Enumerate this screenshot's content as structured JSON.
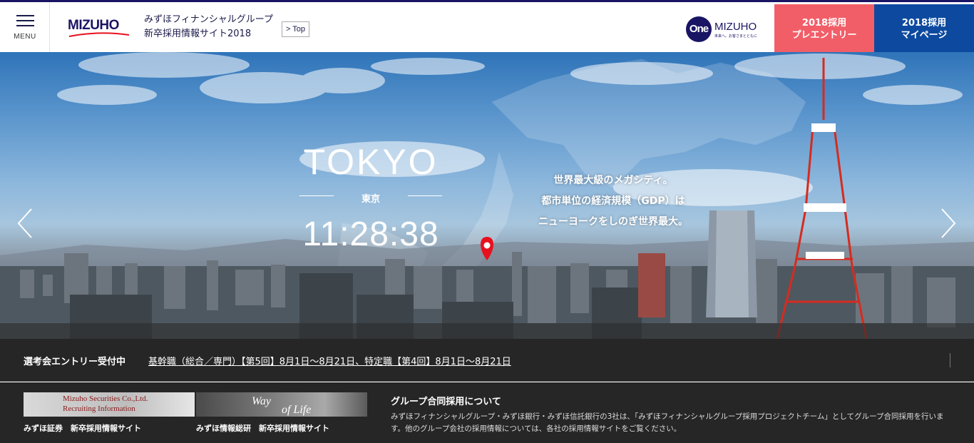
{
  "header": {
    "menu_label": "MENU",
    "logo_text": "MIZUHO",
    "site_title_line1": "みずほフィナンシャルグループ",
    "site_title_line2": "新卒採用情報サイト2018",
    "top_link": "> Top",
    "one_logo_circle": "One",
    "one_logo_text": "MIZUHO",
    "one_logo_tagline": "未来へ。お客さまとともに",
    "entry_button_line1": "2018採用",
    "entry_button_line2": "プレエントリー",
    "mypage_button_line1": "2018採用",
    "mypage_button_line2": "マイページ"
  },
  "hero": {
    "city_name": "TOKYO",
    "city_name_jp": "東京",
    "clock": "11:28:38",
    "desc_line1": "世界最大級のメガシティ。",
    "desc_line2": "都市単位の経済規模（GDP）は",
    "desc_line3": "ニューヨークをしのぎ世界最大。"
  },
  "news": {
    "label": "選考会エントリー受付中",
    "link": "基幹職（総合／専門）【第5回】8月1日〜8月21日、特定職【第4回】8月1日〜8月21日"
  },
  "footer": {
    "banner1_line1": "Mizuho Securities Co.,Ltd.",
    "banner1_line2": "Recruiting Information",
    "banner1_caption": "みずほ証券　新卒採用情報サイト",
    "banner2_line1": "Way",
    "banner2_line2": "of Life",
    "banner2_caption": "みずほ情報総研　新卒採用情報サイト",
    "group_title": "グループ合同採用について",
    "group_text": "みずほフィナンシャルグループ・みずほ銀行・みずほ信託銀行の3社は、「みずほフィナンシャルグループ採用プロジェクトチーム」としてグループ合同採用を行います。他のグループ会社の採用情報については、各社の採用情報サイトをご覧ください。"
  },
  "colors": {
    "brand_navy": "#1a1464",
    "entry_pink": "#f25e68",
    "mypage_blue": "#0d4a9f",
    "pin_red": "#e8101e"
  }
}
